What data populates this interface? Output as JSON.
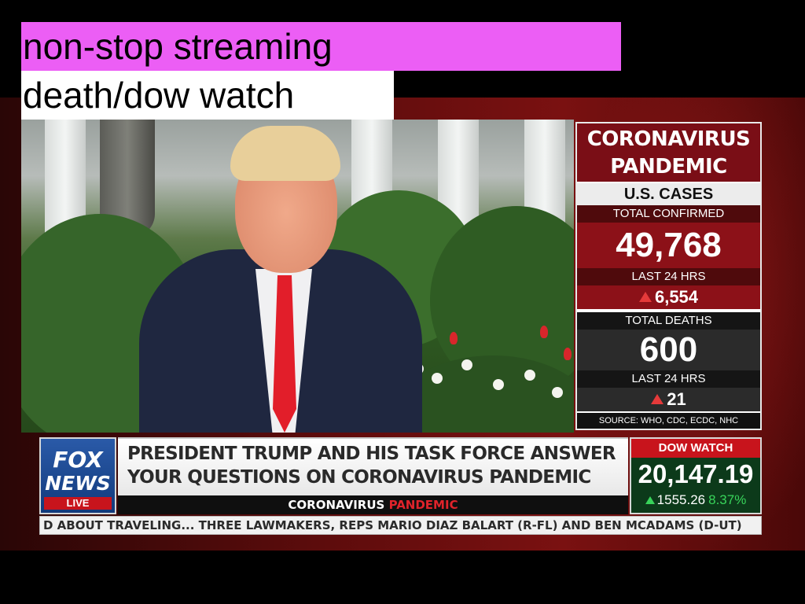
{
  "overlay": {
    "caption_line1": "non-stop streaming",
    "caption_line2": "death/dow watch"
  },
  "stats_panel": {
    "title_line1": "CORONAVIRUS",
    "title_line2": "PANDEMIC",
    "subtitle": "U.S. CASES",
    "confirmed_label": "TOTAL CONFIRMED",
    "confirmed_value": "49,768",
    "confirmed_24h_label": "LAST 24 HRS",
    "confirmed_24h_value": "6,554",
    "deaths_label": "TOTAL DEATHS",
    "deaths_value": "600",
    "deaths_24h_label": "LAST 24 HRS",
    "deaths_24h_value": "21",
    "source": "SOURCE: WHO, CDC, ECDC, NHC"
  },
  "network": {
    "logo_line1": "FOX",
    "logo_line2": "NEWS",
    "live": "LIVE"
  },
  "headline": {
    "line1": "PRESIDENT TRUMP AND HIS TASK FORCE ANSWER",
    "line2": "YOUR QUESTIONS ON CORONAVIRUS PANDEMIC",
    "topic_part1": "CORONAVIRUS",
    "topic_part2": "PANDEMIC"
  },
  "dow": {
    "label": "DOW WATCH",
    "value": "20,147.19",
    "change": "1555.26",
    "percent": "8.37%"
  },
  "ticker": {
    "text": "D ABOUT TRAVELING...   THREE LAWMAKERS, REPS MARIO DIAZ BALART (R-FL) AND BEN MCADAMS (D-UT)"
  },
  "colors": {
    "caption_highlight": "#ec5ef5",
    "panel_red": "#8c1118",
    "panel_dark": "#2b2b2b",
    "dow_green_bg": "#0c3a1a",
    "tie_red": "#e21e2a"
  }
}
